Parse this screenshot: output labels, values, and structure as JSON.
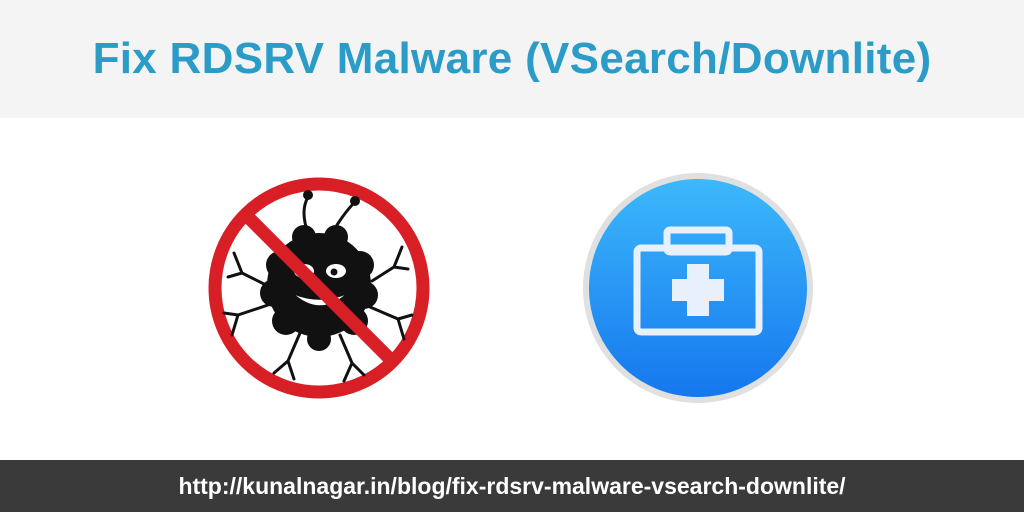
{
  "header": {
    "title": "Fix RDSRV Malware (VSearch/Downlite)"
  },
  "images": {
    "left": {
      "icon": "no-bug-icon",
      "colors": {
        "ring": "#d91f26",
        "bug": "#111111"
      }
    },
    "right": {
      "icon": "first-aid-kit-icon",
      "colors": {
        "circle": "#1c8cf0",
        "symbol": "#e8f1fb"
      }
    }
  },
  "footer": {
    "url": "http://kunalnagar.in/blog/fix-rdsrv-malware-vsearch-downlite/"
  }
}
